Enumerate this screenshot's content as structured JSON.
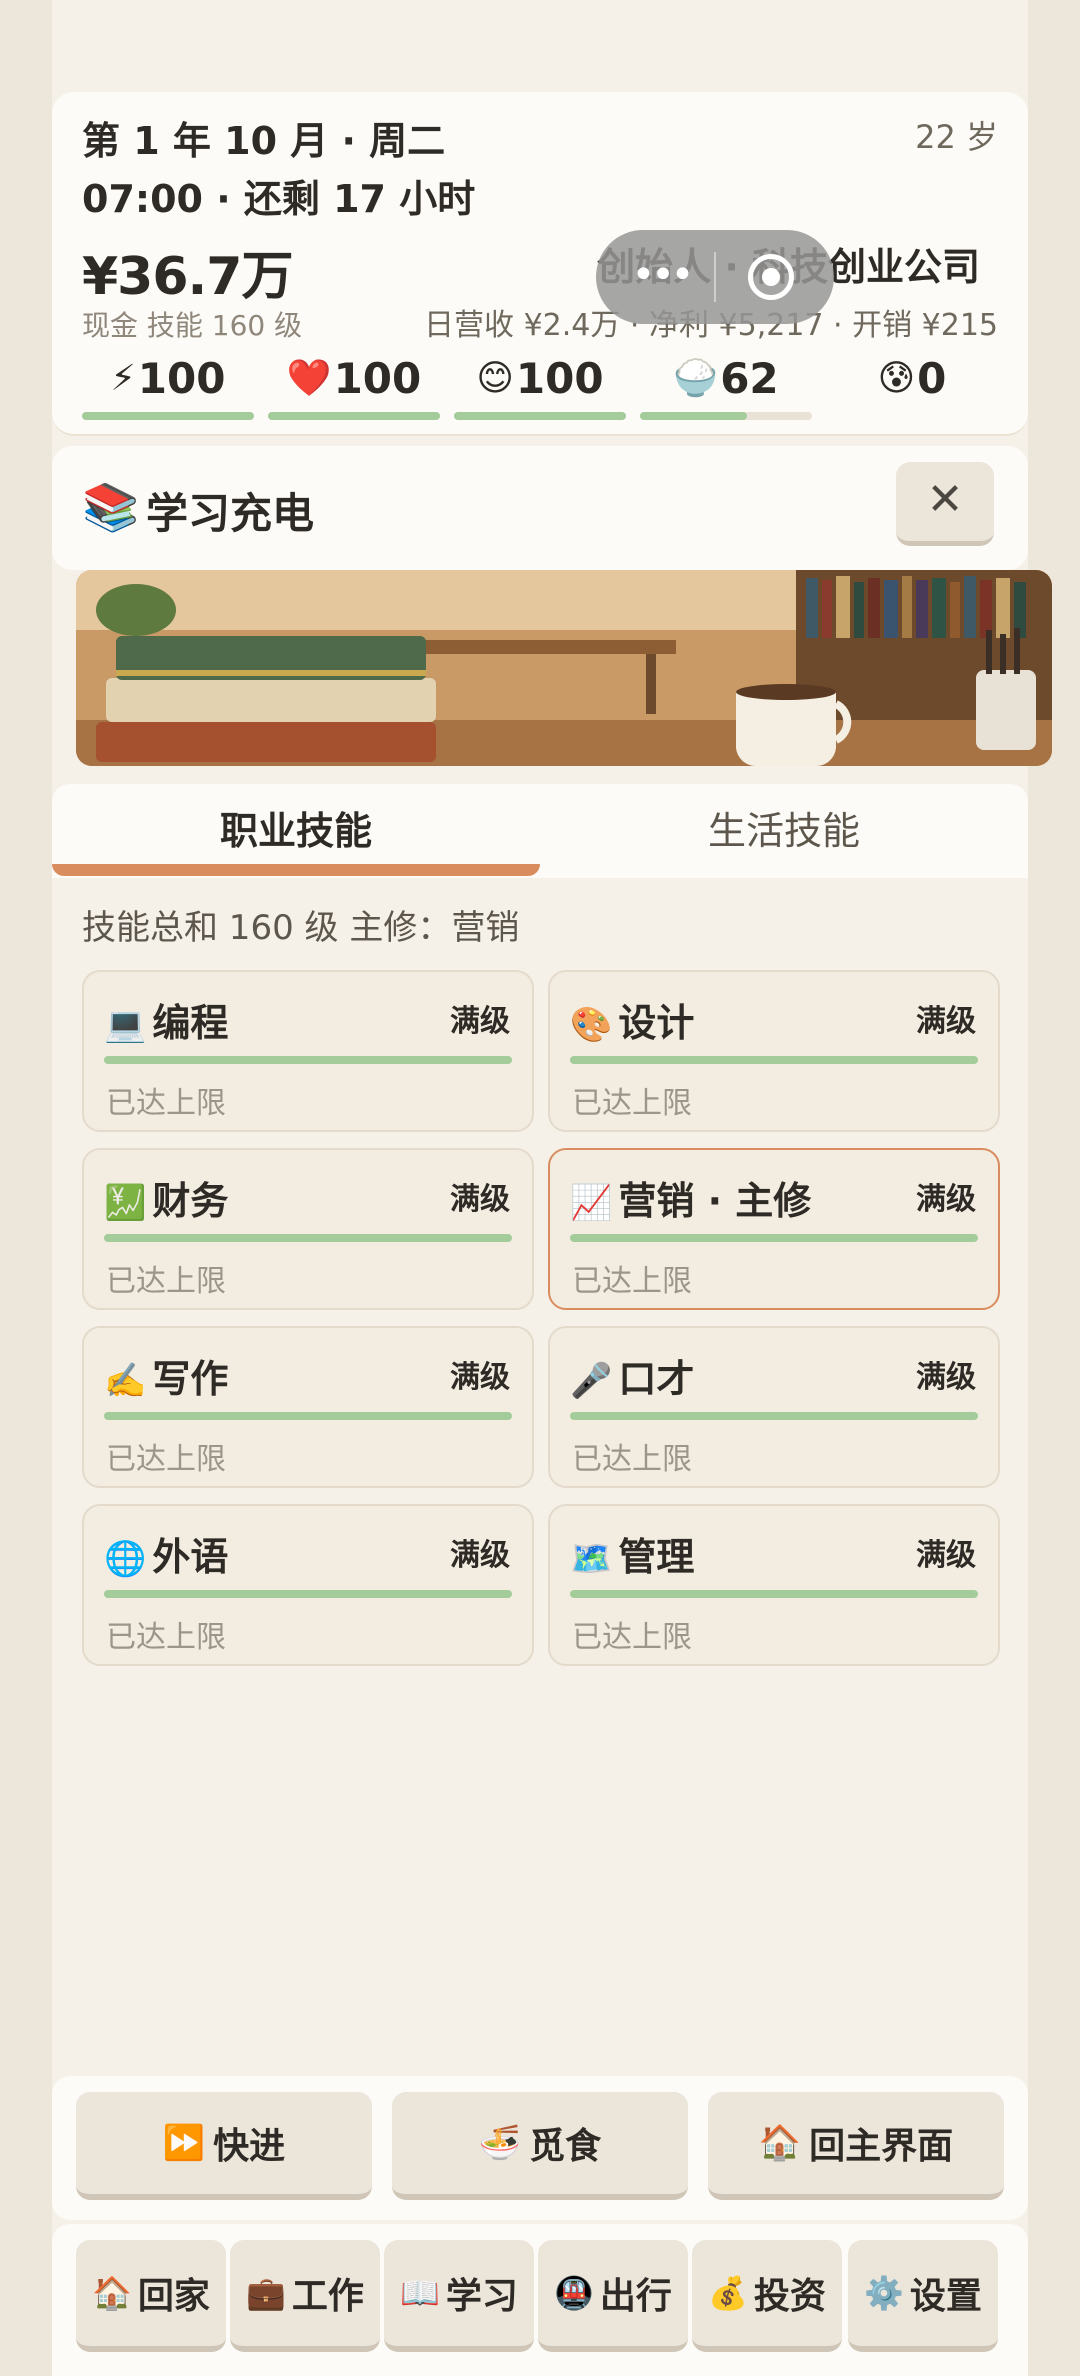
{
  "header": {
    "date": "第 1 年 10 月 · 周二",
    "time": "07:00 · 还剩 17 小时",
    "money": "¥36.7万",
    "money_sub": "现金  技能 160 级",
    "age": "22 岁",
    "company": "创始人 · 科技创业公司",
    "finance": "日营收 ¥2.4万 · 净利 ¥5,217 · 开销 ¥215",
    "stats": [
      {
        "icon": "⚡",
        "icon_name": "energy-icon",
        "value": "100",
        "fill": 1.0
      },
      {
        "icon": "❤️",
        "icon_name": "health-icon",
        "value": "100",
        "fill": 1.0
      },
      {
        "icon": "😊",
        "icon_name": "mood-icon",
        "value": "100",
        "fill": 1.0
      },
      {
        "icon": "🍚",
        "icon_name": "food-icon",
        "value": "62",
        "fill": 0.62
      },
      {
        "icon": "😰",
        "icon_name": "stress-icon",
        "value": "0",
        "fill": 0.0
      }
    ]
  },
  "section": {
    "icon": "📚",
    "title": "学习充电",
    "close": "✕"
  },
  "tabs": [
    {
      "label": "职业技能",
      "active": true
    },
    {
      "label": "生活技能",
      "active": false
    }
  ],
  "summary": "技能总和 160 级   主修：营销",
  "skills": [
    {
      "icon": "💻",
      "name": "编程",
      "level": "满级",
      "note": "已达上限"
    },
    {
      "icon": "🎨",
      "name": "设计",
      "level": "满级",
      "note": "已达上限"
    },
    {
      "icon": "💹",
      "name": "财务",
      "level": "满级",
      "note": "已达上限"
    },
    {
      "icon": "📈",
      "name": "营销 · 主修",
      "level": "满级",
      "note": "已达上限"
    },
    {
      "icon": "✍️",
      "name": "写作",
      "level": "满级",
      "note": "已达上限"
    },
    {
      "icon": "🎤",
      "name": "口才",
      "level": "满级",
      "note": "已达上限"
    },
    {
      "icon": "🌐",
      "name": "外语",
      "level": "满级",
      "note": "已达上限"
    },
    {
      "icon": "🗺️",
      "name": "管理",
      "level": "满级",
      "note": "已达上限"
    }
  ],
  "actions": [
    {
      "icon": "⏩",
      "label": "快进"
    },
    {
      "icon": "🍜",
      "label": "觅食"
    },
    {
      "icon": "🏠",
      "label": "回主界面"
    }
  ],
  "nav": [
    {
      "icon": "🏠",
      "label": "回家"
    },
    {
      "icon": "💼",
      "label": "工作"
    },
    {
      "icon": "📖",
      "label": "学习"
    },
    {
      "icon": "🚇",
      "label": "出行"
    },
    {
      "icon": "💰",
      "label": "投资"
    },
    {
      "icon": "⚙️",
      "label": "设置"
    }
  ],
  "colors": {
    "accent": "#d98d5f",
    "bar_green": "#a3cc9a",
    "background": "#f6f1e8"
  }
}
